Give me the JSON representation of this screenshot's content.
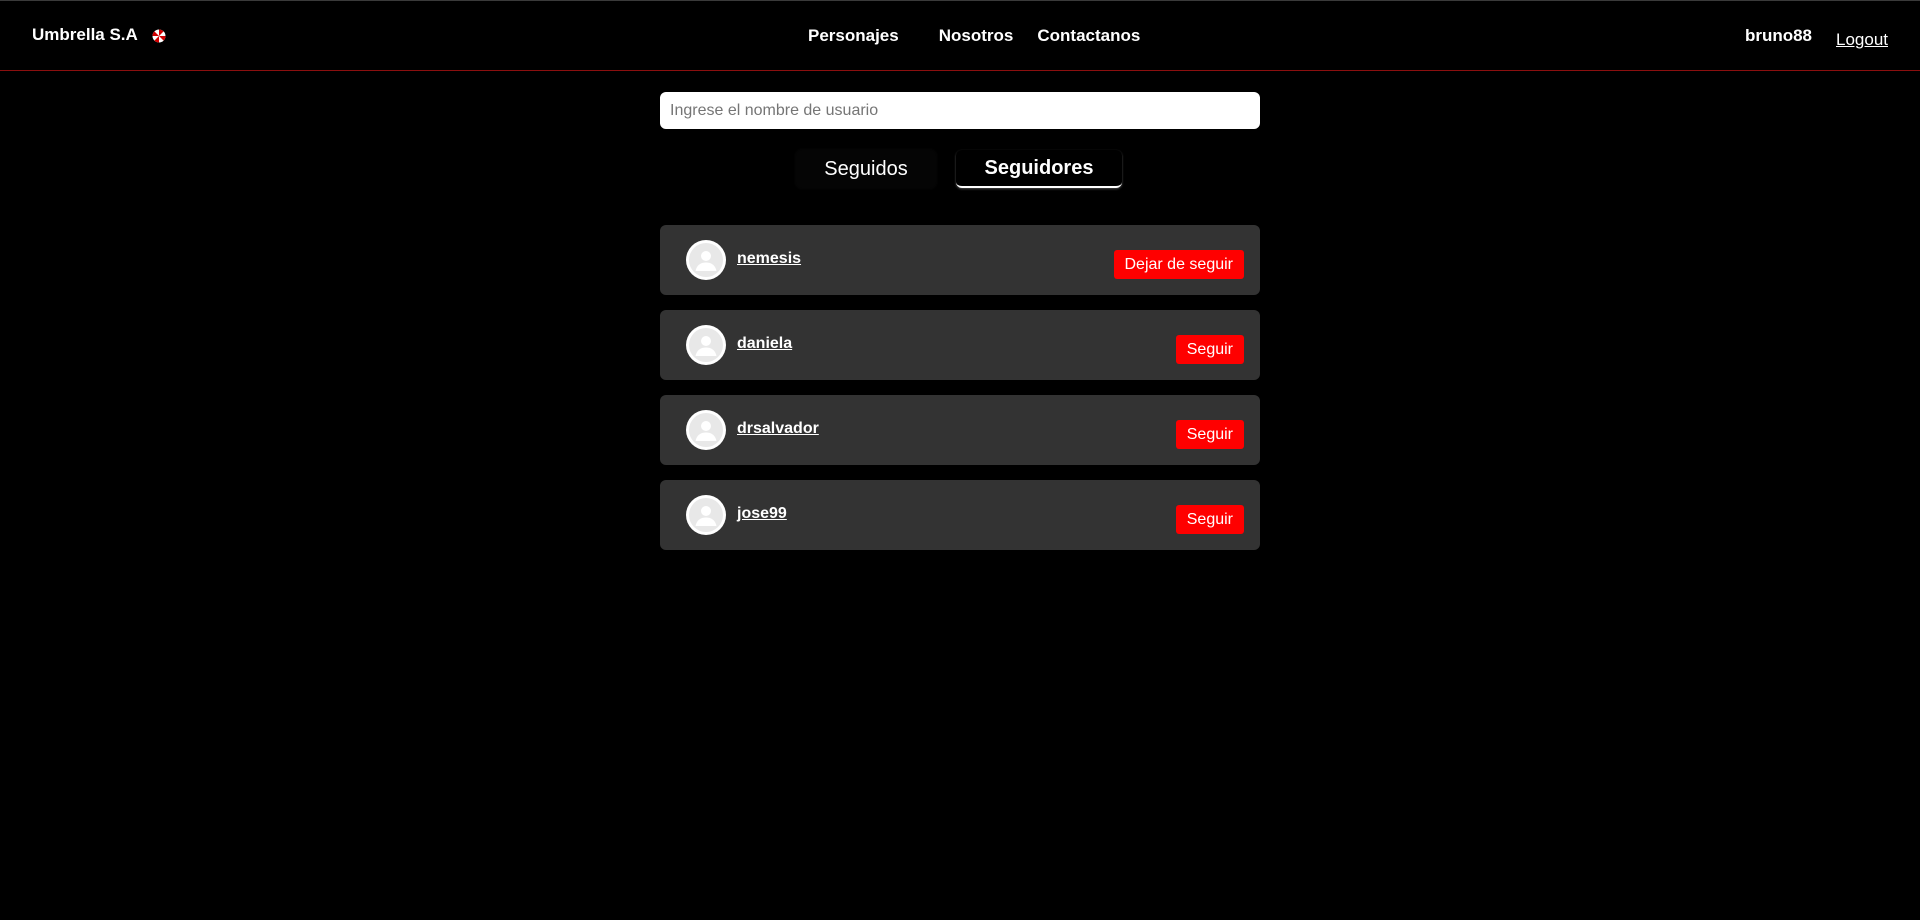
{
  "header": {
    "brand": "Umbrella S.A",
    "brand_icon": "umbrella-logo-icon",
    "nav": [
      "Personajes",
      "Nosotros",
      "Contactanos"
    ],
    "username": "bruno88",
    "logout": "Logout",
    "accent_color": "#8b0f0f"
  },
  "search": {
    "placeholder": "Ingrese el nombre de usuario",
    "value": ""
  },
  "tabs": [
    {
      "label": "Seguidos",
      "active": false
    },
    {
      "label": "Seguidores",
      "active": true
    }
  ],
  "followers": [
    {
      "name": "nemesis",
      "action": "Dejar de seguir",
      "avatar_icon": "default-user-icon"
    },
    {
      "name": "daniela",
      "action": "Seguir",
      "avatar_icon": "default-user-icon"
    },
    {
      "name": "drsalvador",
      "action": "Seguir",
      "avatar_icon": "default-user-icon"
    },
    {
      "name": "jose99",
      "action": "Seguir",
      "avatar_icon": "default-user-icon"
    }
  ],
  "colors": {
    "background": "#000000",
    "card": "#333333",
    "button": "#ff0000"
  }
}
